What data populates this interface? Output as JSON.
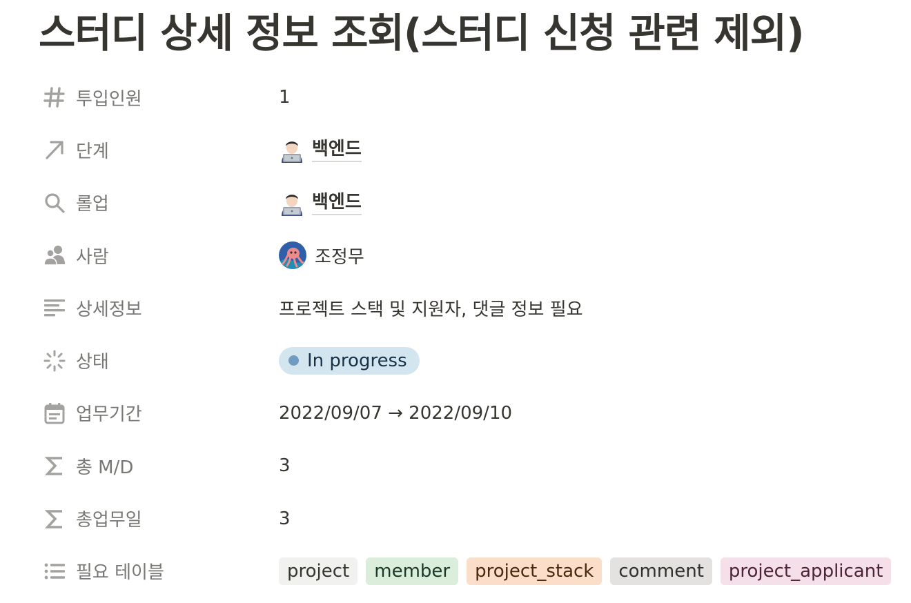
{
  "page": {
    "title": "스터디 상세 정보 조회(스터디 신청 관련 제외)"
  },
  "properties": {
    "headcount": {
      "label": "투입인원",
      "icon": "hash-icon",
      "value": "1"
    },
    "stage": {
      "label": "단계",
      "icon": "arrow-up-right-icon",
      "emoji": "technologist-emoji",
      "value": "백엔드"
    },
    "rollup": {
      "label": "롤업",
      "icon": "magnifier-icon",
      "emoji": "technologist-emoji",
      "value": "백엔드"
    },
    "person": {
      "label": "사람",
      "icon": "people-icon",
      "avatar": "octopus-avatar",
      "value": "조정무"
    },
    "details": {
      "label": "상세정보",
      "icon": "text-lines-icon",
      "value": "프로젝트 스택 및 지원자, 댓글 정보 필요"
    },
    "status": {
      "label": "상태",
      "icon": "loading-spinner-icon",
      "value": "In progress",
      "pill_color": "#d3e5ef",
      "dot_color": "#6f9cc0",
      "text_color": "#183347"
    },
    "period": {
      "label": "업무기간",
      "icon": "calendar-icon",
      "value": "2022/09/07 → 2022/09/10"
    },
    "total_md": {
      "label": "총 M/D",
      "icon": "sigma-icon",
      "value": "3"
    },
    "total_days": {
      "label": "총업무일",
      "icon": "sigma-icon",
      "value": "3"
    },
    "required_tables": {
      "label": "필요 테이블",
      "icon": "bulleted-list-icon",
      "tags": [
        {
          "label": "project",
          "bg": "#f1f1ef",
          "fg": "#37352f"
        },
        {
          "label": "member",
          "bg": "#dbeddb",
          "fg": "#1c3829"
        },
        {
          "label": "project_stack",
          "bg": "#fadec9",
          "fg": "#49290e"
        },
        {
          "label": "comment",
          "bg": "#e3e2e0",
          "fg": "#32302c"
        },
        {
          "label": "project_applicant",
          "bg": "#f5e0e9",
          "fg": "#4c2337"
        }
      ]
    }
  },
  "colors": {
    "text": "#37352f",
    "muted": "#787774",
    "icon": "#a3a29f"
  }
}
